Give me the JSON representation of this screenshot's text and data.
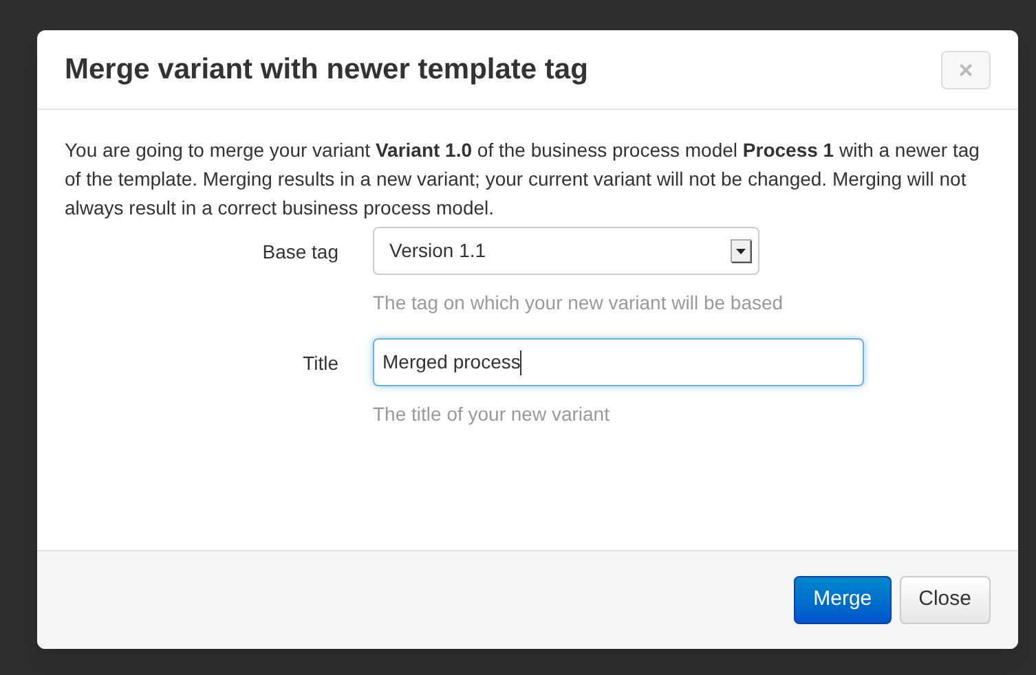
{
  "dialog": {
    "title": "Merge variant with newer template tag",
    "close_icon": "×"
  },
  "intro": "You are going to merge your variant **Variant 1.0** of the business process model **Process 1** with a newer tag of the template. Merging results in a new variant; your current variant will not be changed. Merging will not always result in a correct business process model.",
  "fields": [
    {
      "kind": "select",
      "label": "Base tag",
      "value": "Version 1.1",
      "help": "The tag on which your new variant will be based",
      "focused": false
    },
    {
      "kind": "text",
      "label": "Title",
      "value": "Merged process",
      "help": "The title of your new variant",
      "focused": true
    }
  ],
  "buttons": [
    {
      "label": "Merge",
      "kind": "primary"
    },
    {
      "label": "Close",
      "kind": "default"
    }
  ]
}
